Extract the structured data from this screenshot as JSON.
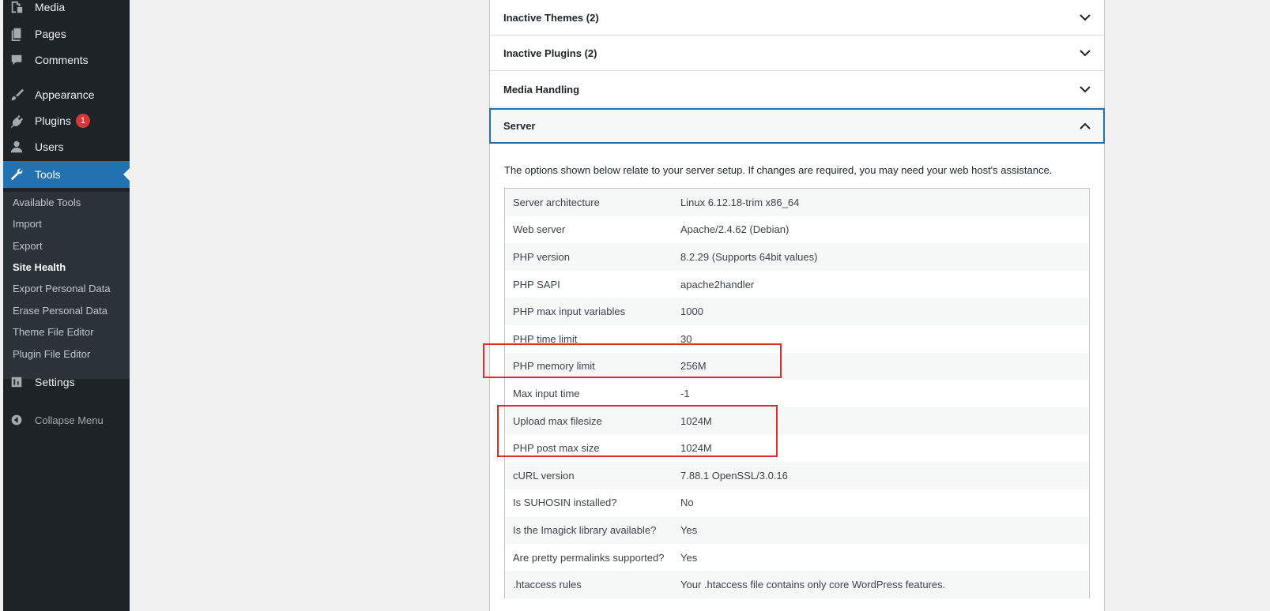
{
  "sidebar": {
    "media": "Media",
    "pages": "Pages",
    "comments": "Comments",
    "appearance": "Appearance",
    "plugins": "Plugins",
    "plugins_badge": "1",
    "users": "Users",
    "tools": "Tools",
    "settings": "Settings",
    "collapse": "Collapse Menu",
    "submenu": [
      "Available Tools",
      "Import",
      "Export",
      "Site Health",
      "Export Personal Data",
      "Erase Personal Data",
      "Theme File Editor",
      "Plugin File Editor"
    ],
    "submenu_current": "Site Health"
  },
  "sections": {
    "inactive_themes": "Inactive Themes (2)",
    "inactive_plugins": "Inactive Plugins (2)",
    "media_handling": "Media Handling",
    "server": "Server"
  },
  "server": {
    "description": "The options shown below relate to your server setup. If changes are required, you may need your web host's assistance.",
    "rows": [
      {
        "label": "Server architecture",
        "value": "Linux 6.12.18-trim x86_64"
      },
      {
        "label": "Web server",
        "value": "Apache/2.4.62 (Debian)"
      },
      {
        "label": "PHP version",
        "value": "8.2.29 (Supports 64bit values)"
      },
      {
        "label": "PHP SAPI",
        "value": "apache2handler"
      },
      {
        "label": "PHP max input variables",
        "value": "1000"
      },
      {
        "label": "PHP time limit",
        "value": "30"
      },
      {
        "label": "PHP memory limit",
        "value": "256M"
      },
      {
        "label": "Max input time",
        "value": "-1"
      },
      {
        "label": "Upload max filesize",
        "value": "1024M"
      },
      {
        "label": "PHP post max size",
        "value": "1024M"
      },
      {
        "label": "cURL version",
        "value": "7.88.1 OpenSSL/3.0.16"
      },
      {
        "label": "Is SUHOSIN installed?",
        "value": "No"
      },
      {
        "label": "Is the Imagick library available?",
        "value": "Yes"
      },
      {
        "label": "Are pretty permalinks supported?",
        "value": "Yes"
      },
      {
        "label": ".htaccess rules",
        "value": "Your .htaccess file contains only core WordPress features."
      }
    ]
  },
  "colors": {
    "sidebar_bg": "#1d2327",
    "submenu_bg": "#2c3338",
    "accent": "#2271b1",
    "badge": "#d63638",
    "annotation": "#e02b2b"
  }
}
